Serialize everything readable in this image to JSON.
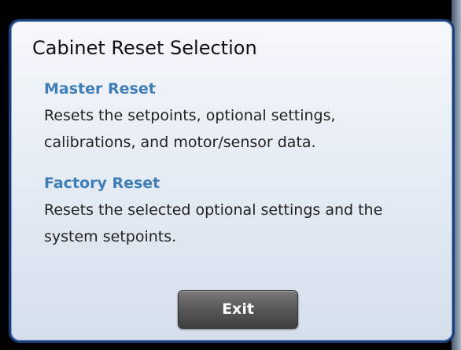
{
  "dialog": {
    "title": "Cabinet Reset Selection",
    "sections": [
      {
        "heading": "Master Reset",
        "description": "Resets the setpoints, optional settings, calibrations, and motor/sensor data."
      },
      {
        "heading": "Factory Reset",
        "description": "Resets the selected optional settings and the system setpoints."
      }
    ],
    "exit_label": "Exit"
  },
  "colors": {
    "heading": "#3e7db6",
    "border": "#1a3f7a",
    "button": "#5a5a5a"
  }
}
